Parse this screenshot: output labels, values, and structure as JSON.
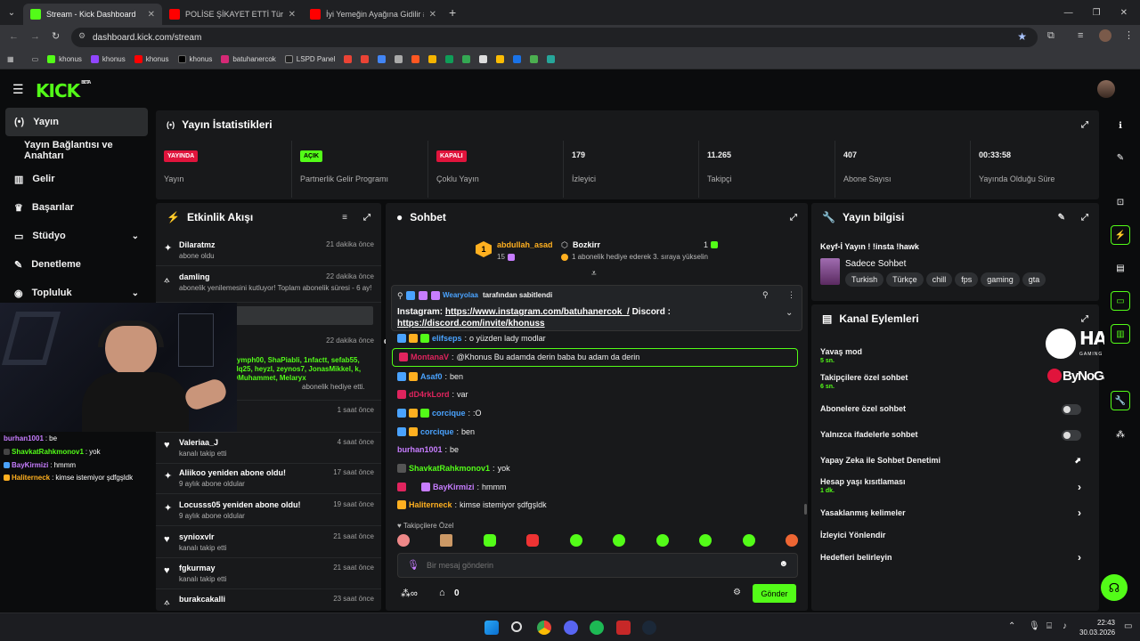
{
  "browser": {
    "tabs": [
      {
        "title": "Stream - Kick Dashboard",
        "active": true
      },
      {
        "title": "POLİSE ŞİKAYET ETTİ Türkiye'de",
        "active": false
      },
      {
        "title": "İyi Yemeğin Ayağına Gidilir #10",
        "active": false
      }
    ],
    "url": "dashboard.kick.com/stream",
    "bookmarks": [
      "khonus",
      "khonus",
      "khonus",
      "khonus",
      "batuhanercok",
      "LSPD Panel"
    ]
  },
  "header": {
    "logo": "KICK",
    "beta": "BETA"
  },
  "sidebar": {
    "items": [
      {
        "label": "Yayın",
        "icon": "broadcast-icon"
      },
      {
        "label": "Yayın Bağlantısı ve Anahtarı",
        "icon": ""
      },
      {
        "label": "Gelir",
        "icon": "revenue-icon"
      },
      {
        "label": "Başarılar",
        "icon": "trophy-icon"
      },
      {
        "label": "Stüdyo",
        "icon": "studio-icon"
      },
      {
        "label": "Denetleme",
        "icon": "moderation-icon"
      },
      {
        "label": "Topluluk",
        "icon": "community-icon"
      }
    ]
  },
  "stats": {
    "title": "Yayın İstatistikleri",
    "cells": [
      {
        "badge": "YAYINDA",
        "label": "Yayın"
      },
      {
        "badge": "AÇIK",
        "label": "Partnerlik Gelir Programı"
      },
      {
        "badge": "KAPALI",
        "label": "Çoklu Yayın"
      },
      {
        "value": "179",
        "label": "İzleyici"
      },
      {
        "value": "11.265",
        "label": "Takipçi"
      },
      {
        "value": "407",
        "label": "Abone Sayısı"
      },
      {
        "value": "00:33:58",
        "label": "Yayında Olduğu Süre"
      }
    ]
  },
  "activity": {
    "title": "Etkinlik Akışı",
    "items": [
      {
        "name": "Dilaratmz",
        "sub": "abone oldu",
        "time": "21 dakika önce"
      },
      {
        "name": "damling",
        "sub": "abonelik yenilemesini kutluyor! Toplam abonelik süresi - 6 ay!",
        "time": "22 dakika önce"
      },
      {
        "name": "d",
        "sub": "nymph00, ShaPiabli, 1nfactt, sefab55, alq25, heyzl, zeynos7, JonasMikkel, k, OMuhammet, Melaryx",
        "sub2": "abonelik hediye etti.",
        "time": "22 dakika önce"
      },
      {
        "name": "",
        "sub": "",
        "time": "1 saat önce"
      },
      {
        "name": "Valeriaa_J",
        "sub": "kanalı takip etti",
        "time": "4 saat önce"
      },
      {
        "name": "Aliikoo yeniden abone oldu!",
        "sub": "9 aylık abone oldular",
        "time": "17 saat önce"
      },
      {
        "name": "Locusss05 yeniden abone oldu!",
        "sub": "9 aylık abone oldular",
        "time": "19 saat önce"
      },
      {
        "name": "synioxvlr",
        "sub": "kanalı takip etti",
        "time": "21 saat önce"
      },
      {
        "name": "fgkurmay",
        "sub": "kanalı takip etti",
        "time": "21 saat önce"
      },
      {
        "name": "burakcakalli",
        "sub": "",
        "time": "23 saat önce"
      }
    ]
  },
  "chat": {
    "title": "Sohbet",
    "top_gifter": {
      "name": "abdullah_asad",
      "count": "15",
      "rank": "1"
    },
    "gift_event": {
      "name": "Bozkirr",
      "count": "1",
      "text": "1 abonelik hediye ederek 3. sıraya yükselin"
    },
    "pinned": {
      "by": "Wearyolaa",
      "by_suffix": "tarafından sabitlendi",
      "text_prefix": "Instagram:",
      "link1": "https://www.instagram.com/batuhanercok_/",
      "mid": "Discord :",
      "link2": "https://discord.com/invite/khonuss"
    },
    "messages": [
      {
        "user": "elifseps",
        "text": "o yüzden lady modlar",
        "color": "#4aa3ff"
      },
      {
        "user": "MontanaV",
        "text": "@Khonus Bu adamda derin baba bu adam da derin",
        "color": "#e0245e"
      },
      {
        "user": "Asaf0",
        "text": "ben",
        "color": "#4aa3ff"
      },
      {
        "user": "dD4rkLord",
        "text": "var",
        "color": "#e0245e"
      },
      {
        "user": "corcique",
        "text": ":O",
        "color": "#4aa3ff"
      },
      {
        "user": "corcique",
        "text": "ben",
        "color": "#4aa3ff"
      },
      {
        "user": "burhan1001",
        "text": "be",
        "color": "#c77dff"
      },
      {
        "user": "ShavkatRahkmonov1",
        "text": "yok",
        "color": "#53fc18"
      },
      {
        "user": "BayKirmizi",
        "text": "hmmm",
        "color": "#c77dff"
      },
      {
        "user": "Haliterneck",
        "text": "kimse istemiyor şdfgşldk",
        "color": "#ffb020"
      }
    ],
    "mode": "Takipçilere Özel",
    "placeholder": "Bir mesaj gönderin",
    "points": "0",
    "send": "Gönder"
  },
  "info": {
    "title": "Yayın bilgisi",
    "stream_title": "Keyf-İ Yayın ! !insta !hawk",
    "category": "Sadece Sohbet",
    "tags": [
      "Turkish",
      "Türkçe",
      "chill",
      "fps",
      "gaming",
      "gta"
    ]
  },
  "actions": {
    "title": "Kanal Eylemleri",
    "rows": [
      {
        "label": "Yavaş mod",
        "sub": "5 sn."
      },
      {
        "label": "Takipçilere özel sohbet",
        "sub": "6 sn."
      },
      {
        "label": "Abonelere özel sohbet",
        "sub": ""
      },
      {
        "label": "Yalnızca ifadelerle sohbet",
        "sub": ""
      },
      {
        "label": "Yapay Zeka ile Sohbet Denetimi",
        "sub": ""
      },
      {
        "label": "Hesap yaşı kısıtlaması",
        "sub": "1 dk."
      },
      {
        "label": "Yasaklanmış kelimeler",
        "sub": ""
      },
      {
        "label": "İzleyici Yönlendir",
        "sub": ""
      },
      {
        "label": "Hedefleri belirleyin",
        "sub": ""
      }
    ]
  },
  "overlay": {
    "brand1": "HAWK",
    "brand1_sub": "GAMING CHAIR",
    "brand2": "ByNoGame",
    "chat": [
      {
        "user": "burhan1001",
        "text": "be",
        "color": "#c77dff"
      },
      {
        "user": "ShavkatRahkmonov1",
        "text": "yok",
        "color": "#53fc18"
      },
      {
        "user": "BayKirmizi",
        "text": "hmmm",
        "color": "#c77dff"
      },
      {
        "user": "Haliterneck",
        "text": "kimse istemiyor şdfgşldk",
        "color": "#ffb020"
      }
    ]
  },
  "taskbar": {
    "time": "22:43",
    "date": "30.03.2026"
  },
  "colors": {
    "accent": "#53fc18",
    "live": "#e0143c"
  }
}
